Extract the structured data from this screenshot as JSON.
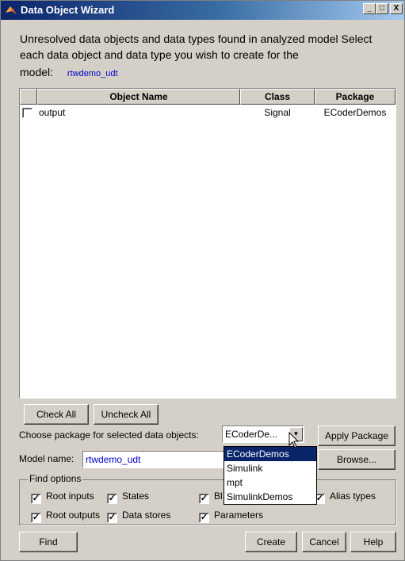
{
  "window": {
    "title": "Data Object Wizard",
    "controls": {
      "minimize": "_",
      "maximize": "□",
      "close": "X"
    }
  },
  "intro": {
    "text": "Unresolved data objects and data types found in analyzed model Select each data object and data type you wish to create for the",
    "model_label": "model:",
    "model_value": "rtwdemo_udt"
  },
  "table": {
    "columns": [
      "Object Name",
      "Class",
      "Package"
    ],
    "rows": [
      {
        "checked": false,
        "name": "output",
        "class": "Signal",
        "package": "ECoderDemos"
      }
    ]
  },
  "buttons": {
    "check_all": "Check All",
    "uncheck_all": "Uncheck All",
    "apply_package": "Apply Package",
    "browse": "Browse...",
    "find": "Find",
    "create": "Create",
    "cancel": "Cancel",
    "help": "Help"
  },
  "package_chooser": {
    "label": "Choose package for selected data objects:",
    "selected": "ECoderDe...",
    "options": [
      "ECoderDemos",
      "Simulink",
      "mpt",
      "SimulinkDemos"
    ],
    "highlighted_index": 0
  },
  "model_name": {
    "label": "Model name:",
    "value": "rtwdemo_udt"
  },
  "find_options": {
    "legend": "Find options",
    "items": [
      {
        "label": "Root inputs",
        "checked": true
      },
      {
        "label": "States",
        "checked": true
      },
      {
        "label": "Bl",
        "checked": true
      },
      {
        "label": "Alias types",
        "checked": true
      },
      {
        "label": "Root outputs",
        "checked": true
      },
      {
        "label": "Data stores",
        "checked": true
      },
      {
        "label": "Parameters",
        "checked": true
      }
    ]
  },
  "colors": {
    "titlebar_start": "#0a246a",
    "titlebar_end": "#a6caf0",
    "face": "#d4d0c8",
    "link_blue": "#0000cc",
    "selection": "#0a246a"
  },
  "icons": {
    "app": "matlab-logo-icon",
    "combo_arrow": "triangle-down",
    "cursor": "arrow-pointer"
  }
}
